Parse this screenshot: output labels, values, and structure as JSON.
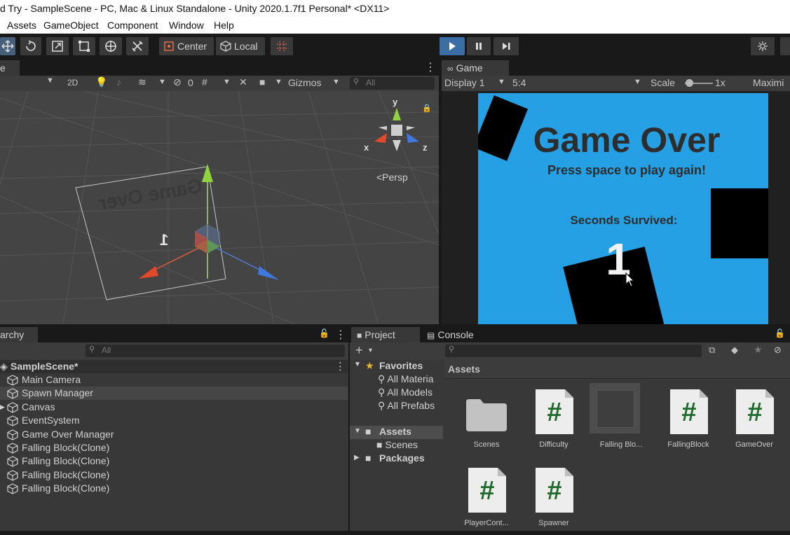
{
  "window": {
    "title": "d Try - SampleScene - PC, Mac & Linux Standalone - Unity 2020.1.7f1 Personal* <DX11>"
  },
  "menu": [
    "Assets",
    "GameObject",
    "Component",
    "Window",
    "Help"
  ],
  "toolbar": {
    "center_label": "Center",
    "local_label": "Local"
  },
  "scene_panel": {
    "tab_label": "e",
    "controls": {
      "mode_2d": "2D",
      "hidden_count": "0",
      "gizmos_label": "Gizmos",
      "search_placeholder": "All"
    },
    "overlay": {
      "persp_label": "<Persp",
      "axis_x": "x",
      "axis_y": "y",
      "axis_z": "z",
      "mirrored_text_title": "Game Over",
      "mirrored_text_number": "1"
    }
  },
  "game_panel": {
    "tab_label": "Game",
    "display_label": "Display 1",
    "aspect_label": "5:4",
    "scale_label": "Scale",
    "scale_value": "1x",
    "maximize_label": "Maximi",
    "canvas": {
      "title": "Game Over",
      "subtitle": "Press space to play again!",
      "seconds_label": "Seconds Survived:",
      "seconds_value": "1"
    },
    "colors": {
      "background": "#25a0e4",
      "block": "#000000",
      "text": "#2d2d2d"
    }
  },
  "hierarchy": {
    "tab_label": "archy",
    "search_placeholder": "All",
    "scene_name": "SampleScene*",
    "items": [
      "Main Camera",
      "Spawn Manager",
      "Canvas",
      "EventSystem",
      "Game Over Manager",
      "Falling Block(Clone)",
      "Falling Block(Clone)",
      "Falling Block(Clone)",
      "Falling Block(Clone)"
    ],
    "selected_index": 1
  },
  "project": {
    "tab_project": "Project",
    "tab_console": "Console",
    "tree": {
      "favorites_label": "Favorites",
      "favorites": [
        "All Materia",
        "All Models",
        "All Prefabs"
      ],
      "assets_label": "Assets",
      "assets_children": [
        "Scenes"
      ],
      "packages_label": "Packages"
    },
    "breadcrumb": "Assets",
    "assets": [
      {
        "name": "Scenes",
        "type": "folder-icon"
      },
      {
        "name": "Difficulty",
        "type": "script-icon"
      },
      {
        "name": "Falling Blo...",
        "type": "prefab-icon"
      },
      {
        "name": "FallingBlock",
        "type": "script-icon"
      },
      {
        "name": "GameOver",
        "type": "script-icon"
      },
      {
        "name": "PlayerCont...",
        "type": "script-icon"
      },
      {
        "name": "Spawner",
        "type": "script-icon"
      }
    ]
  }
}
